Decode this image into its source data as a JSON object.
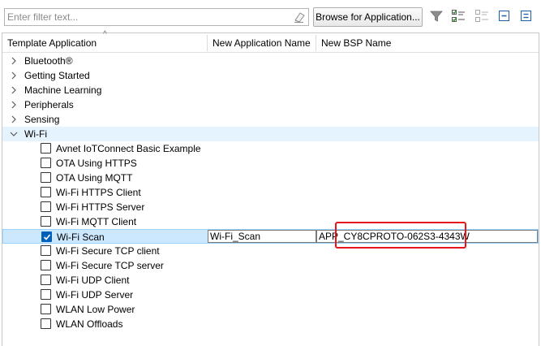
{
  "toolbar": {
    "filter_placeholder": "Enter filter text...",
    "filter_value": "",
    "browse_label": "Browse for Application...",
    "icons": [
      "filter-icon",
      "checklist-icon",
      "checklist-disabled-icon",
      "collapse-all-icon",
      "expand-all-icon"
    ]
  },
  "table": {
    "columns": [
      "Template Application",
      "New Application Name",
      "New BSP Name"
    ],
    "categories": [
      {
        "label": "Bluetooth®",
        "expanded": false
      },
      {
        "label": "Getting Started",
        "expanded": false
      },
      {
        "label": "Machine Learning",
        "expanded": false
      },
      {
        "label": "Peripherals",
        "expanded": false
      },
      {
        "label": "Sensing",
        "expanded": false
      },
      {
        "label": "Wi-Fi",
        "expanded": true
      }
    ],
    "wifi_apps": [
      {
        "label": "Avnet IoTConnect Basic Example",
        "checked": false
      },
      {
        "label": "OTA Using HTTPS",
        "checked": false
      },
      {
        "label": "OTA Using MQTT",
        "checked": false
      },
      {
        "label": "Wi-Fi HTTPS Client",
        "checked": false
      },
      {
        "label": "Wi-Fi HTTPS Server",
        "checked": false
      },
      {
        "label": "Wi-Fi MQTT Client",
        "checked": false
      },
      {
        "label": "Wi-Fi Scan",
        "checked": true,
        "app_name": "Wi-Fi_Scan",
        "bsp_name": "APP_CY8CPROTO-062S3-4343W"
      },
      {
        "label": "Wi-Fi Secure TCP client",
        "checked": false
      },
      {
        "label": "Wi-Fi Secure TCP server",
        "checked": false
      },
      {
        "label": "Wi-Fi UDP Client",
        "checked": false
      },
      {
        "label": "Wi-Fi UDP Server",
        "checked": false
      },
      {
        "label": "WLAN Low Power",
        "checked": false
      },
      {
        "label": "WLAN Offloads",
        "checked": false
      }
    ]
  },
  "colors": {
    "selection": "#cce8ff",
    "hover": "#e5f3ff",
    "checkbox_checked": "#005fb8",
    "annotation": "#e8151a"
  }
}
